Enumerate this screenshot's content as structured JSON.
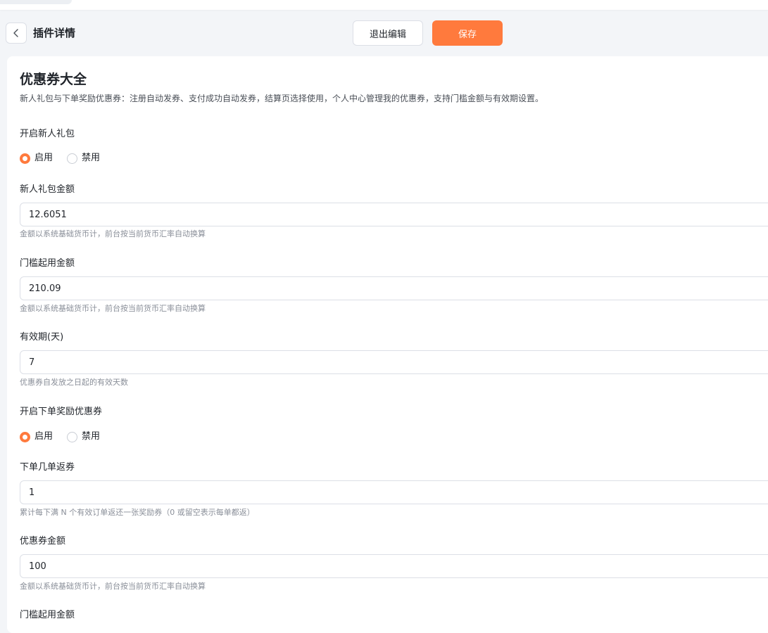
{
  "header": {
    "title": "插件详情",
    "exit_label": "退出编辑",
    "save_label": "保存",
    "accent_color": "#ff7a3d"
  },
  "plugin": {
    "title": "优惠券大全",
    "description": "新人礼包与下单奖励优惠券：注册自动发券、支付成功自动发券，结算页选择使用，个人中心管理我的优惠券，支持门槛金额与有效期设置。"
  },
  "form": {
    "new_user_gift": {
      "label": "开启新人礼包",
      "options": [
        "启用",
        "禁用"
      ],
      "selected": "启用"
    },
    "gift_amount": {
      "label": "新人礼包金额",
      "value": "12.6051",
      "hint": "金额以系统基础货币计，前台按当前货币汇率自动换算"
    },
    "threshold_amount": {
      "label": "门槛起用金额",
      "value": "210.09",
      "hint": "金额以系统基础货币计，前台按当前货币汇率自动换算"
    },
    "validity_days": {
      "label": "有效期(天)",
      "value": "7",
      "hint": "优惠券自发放之日起的有效天数"
    },
    "order_reward": {
      "label": "开启下单奖励优惠券",
      "options": [
        "启用",
        "禁用"
      ],
      "selected": "启用"
    },
    "orders_per_coupon": {
      "label": "下单几单返券",
      "value": "1",
      "hint": "累计每下满 N 个有效订单返还一张奖励券（0 或留空表示每单都返）"
    },
    "coupon_amount": {
      "label": "优惠券金额",
      "value": "100",
      "hint": "金额以系统基础货币计，前台按当前货币汇率自动换算"
    },
    "reward_threshold": {
      "label": "门槛起用金额"
    }
  }
}
